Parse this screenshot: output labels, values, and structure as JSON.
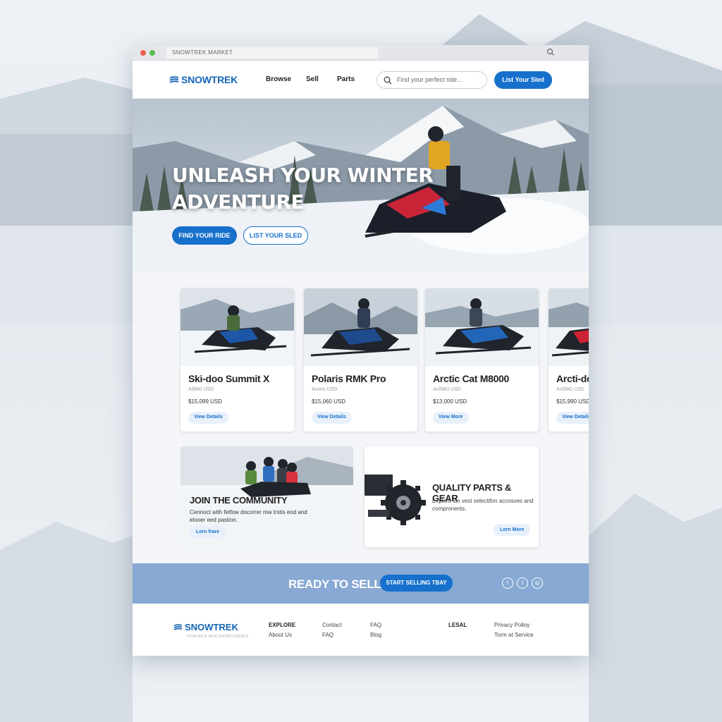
{
  "browser": {
    "url_text": "SNOWTREK MARKET"
  },
  "nav": {
    "brand": "SNOWTREK",
    "links": [
      "Browse",
      "Sell",
      "Parts"
    ],
    "search_placeholder": "Find your perfect ride...",
    "list_button": "List Your Sled"
  },
  "hero": {
    "title_line1": "UNLEASH YOUR WINTER",
    "title_line2": "ADVENTURE",
    "primary_button": "FIND YOUR RIDE",
    "secondary_button": "LIST YOUR SLED"
  },
  "listings": [
    {
      "title": "Ski-doo Summit X",
      "sub": "Aб8Ю USD",
      "price": "$15,099 USD",
      "button": "View Details",
      "sled_color": "#1e56a8"
    },
    {
      "title": "Polaris RMK Pro",
      "sub": "Acorю USD",
      "price": "$15,060 USD",
      "button": "View Details",
      "sled_color": "#1e4a8e"
    },
    {
      "title": "Arctic Cat M8000",
      "sub": "Acδ8Ю USD",
      "price": "$13,000 USD",
      "button": "View More",
      "sled_color": "#2266b8"
    },
    {
      "title": "Arcti-do",
      "sub": "Acб8Ю USD",
      "price": "$15,990 USD",
      "button": "View Details",
      "sled_color": "#cc2233"
    }
  ],
  "community": {
    "title": "JOIN THE COMMUNITY",
    "desc": "Cennoct with fetfow docorrer mw trstis eod and elooer eed pastion.",
    "button": "Lorn frare"
  },
  "parts": {
    "title": "QUALITY PARTS & GEAR",
    "desc": "Explore sin vest selectifon accosves and compronents.",
    "button": "Lorn More"
  },
  "cta": {
    "question": "READY TO SELL?",
    "button": "START SELLING TBAY"
  },
  "social_icons": [
    "twitter-icon",
    "twitter-icon",
    "instagram-icon"
  ],
  "footer": {
    "brand": "SNOWTREK",
    "tagline": "TOUR RICK MOS SNOWTOCKKES",
    "explore_head": "EXPLORE",
    "explore_item": "About Us",
    "col2": [
      "Contact",
      "FAQ"
    ],
    "col3": [
      "FAQ",
      "Blog"
    ],
    "legal_head": "LESAL",
    "legal": [
      "Privacy Polloy",
      "Torm at Service"
    ]
  },
  "colors": {
    "accent": "#1670cc",
    "brand": "#1465b5",
    "cta_band": "#87a9d3"
  }
}
